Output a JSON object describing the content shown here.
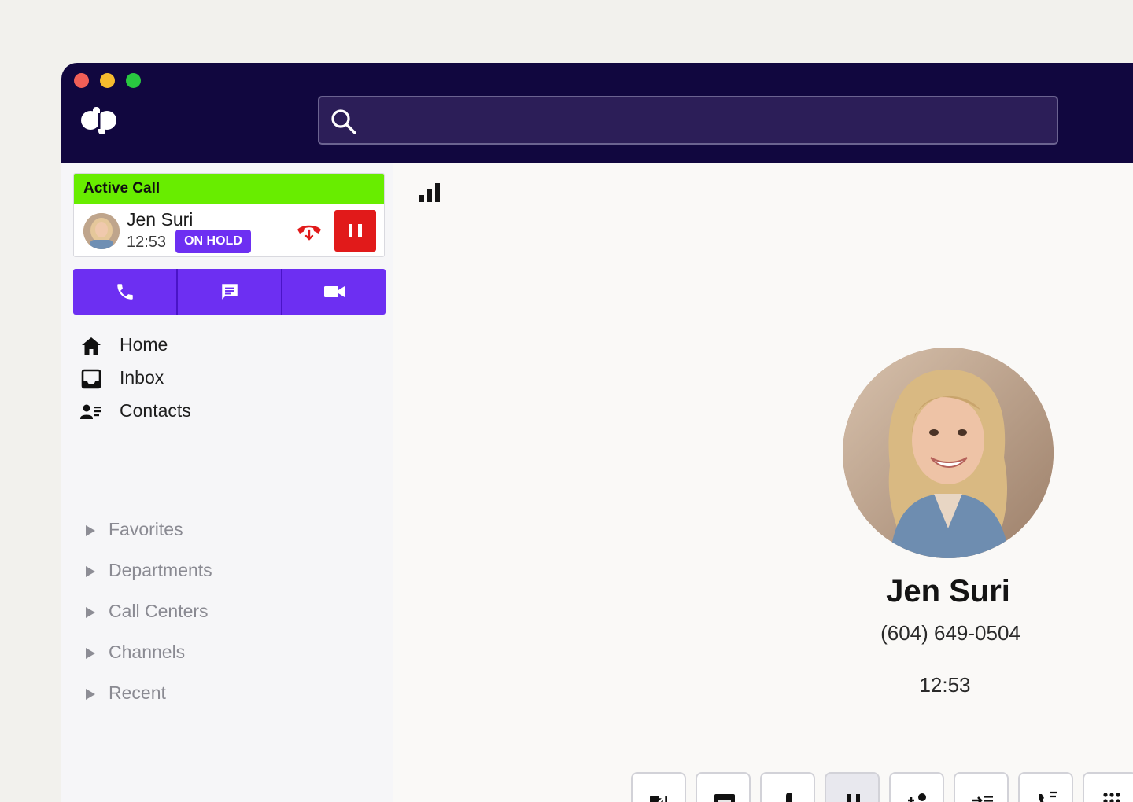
{
  "app": {
    "window_controls": [
      "close",
      "minimize",
      "zoom"
    ],
    "logo_icon": "dialpad-logo-icon"
  },
  "search": {
    "placeholder": "",
    "value": "",
    "icon": "search-icon"
  },
  "active_call": {
    "banner_label": "Active Call",
    "caller_name": "Jen Suri",
    "elapsed": "12:53",
    "status_badge": "ON HOLD",
    "hangup_icon": "hang-up-icon",
    "hold_icon": "pause-icon"
  },
  "quick_actions": [
    {
      "name": "call",
      "icon": "phone-icon"
    },
    {
      "name": "message",
      "icon": "message-icon"
    },
    {
      "name": "video",
      "icon": "video-camera-icon"
    }
  ],
  "nav": {
    "items": [
      {
        "label": "Home",
        "icon": "home-icon"
      },
      {
        "label": "Inbox",
        "icon": "inbox-icon"
      },
      {
        "label": "Contacts",
        "icon": "contacts-icon"
      }
    ],
    "groups": [
      {
        "label": "Favorites"
      },
      {
        "label": "Departments"
      },
      {
        "label": "Call Centers"
      },
      {
        "label": "Channels"
      },
      {
        "label": "Recent"
      }
    ]
  },
  "main": {
    "signal_icon": "signal-strength-icon",
    "contact": {
      "name": "Jen Suri",
      "phone": "(604) 649-0504",
      "timer": "12:53"
    },
    "call_controls": [
      {
        "name": "transfer",
        "icon": "transfer-icon",
        "active": false
      },
      {
        "name": "record",
        "icon": "record-icon",
        "active": false
      },
      {
        "name": "mute",
        "icon": "microphone-icon",
        "active": false
      },
      {
        "name": "hold",
        "icon": "pause-icon",
        "active": true
      },
      {
        "name": "add-caller",
        "icon": "add-person-icon",
        "active": false
      },
      {
        "name": "queue",
        "icon": "queue-icon",
        "active": false
      },
      {
        "name": "park",
        "icon": "call-park-icon",
        "active": false
      },
      {
        "name": "keypad",
        "icon": "keypad-icon",
        "active": false
      }
    ]
  },
  "colors": {
    "titlebar": "#11073f",
    "accent": "#6d2ff2",
    "active_banner": "#68ed00",
    "danger": "#e11a1a",
    "sidebar_bg": "#f6f6f8"
  }
}
